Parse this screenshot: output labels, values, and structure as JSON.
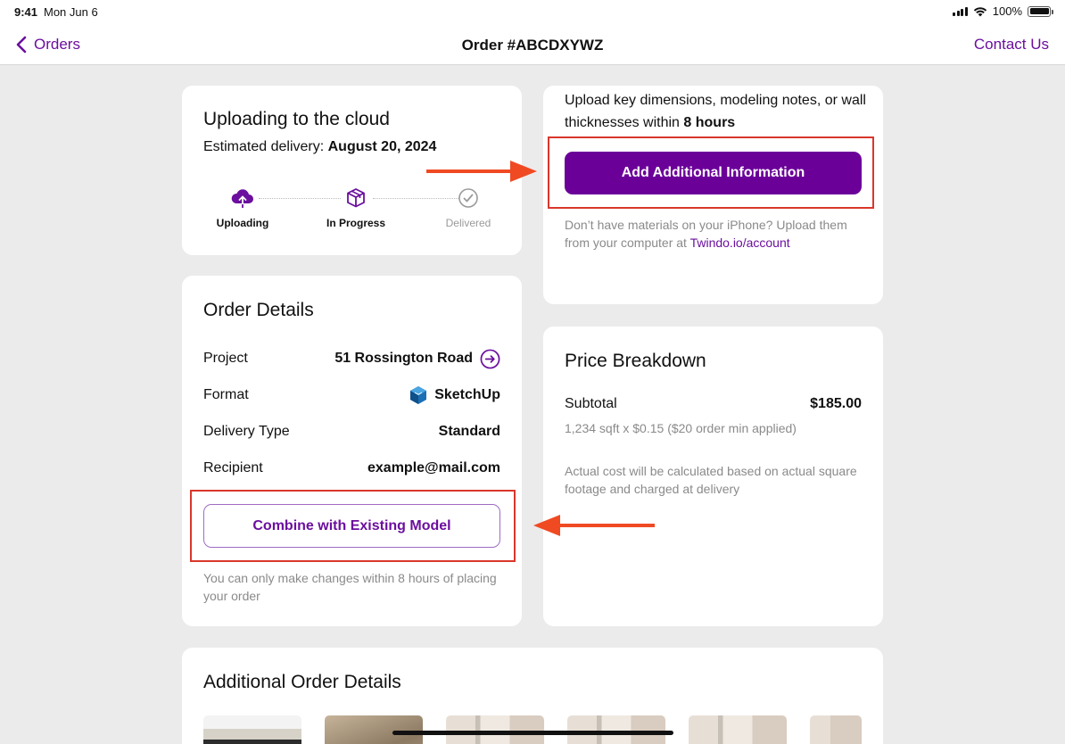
{
  "status_bar": {
    "time": "9:41",
    "date": "Mon Jun 6",
    "battery": "100%"
  },
  "nav": {
    "back_label": "Orders",
    "title": "Order #ABCDXYWZ",
    "contact_label": "Contact Us"
  },
  "status_card": {
    "title": "Uploading to the cloud",
    "est_label": "Estimated delivery:",
    "est_date": "August 20, 2024",
    "steps": [
      {
        "label": "Uploading",
        "icon": "cloud-upload-icon",
        "state": "active"
      },
      {
        "label": "In Progress",
        "icon": "box-icon",
        "state": "active"
      },
      {
        "label": "Delivered",
        "icon": "check-circle-icon",
        "state": "pending"
      }
    ]
  },
  "upload_card": {
    "text_before": "Upload key dimensions, modeling notes, or wall thicknesses within",
    "text_bold": "8 hours",
    "button_label": "Add Additional Information",
    "note_text": "Don’t have materials on your iPhone? Upload them from your computer at",
    "note_link": "Twindo.io/account"
  },
  "details_card": {
    "title": "Order Details",
    "rows": [
      {
        "label": "Project",
        "value": "51 Rossington Road",
        "icon": "arrow-right-circle-icon"
      },
      {
        "label": "Format",
        "value": "SketchUp",
        "icon": "sketchup-logo-icon"
      },
      {
        "label": "Delivery Type",
        "value": "Standard"
      },
      {
        "label": "Recipient",
        "value": "example@mail.com"
      }
    ],
    "button_label": "Combine with Existing Model",
    "note": "You can only make changes within 8 hours of placing your order"
  },
  "price_card": {
    "title": "Price Breakdown",
    "subtotal_label": "Subtotal",
    "subtotal_value": "$185.00",
    "calc": "1,234 sqft x $0.15 ($20 order min applied)",
    "note": "Actual cost will be calculated based on actual square footage and charged at delivery"
  },
  "additional_card": {
    "title": "Additional Order Details"
  },
  "colors": {
    "accent": "#6b0f9e",
    "button": "#6b0099",
    "highlight": "#d9372b",
    "arrow": "#f04a23"
  }
}
